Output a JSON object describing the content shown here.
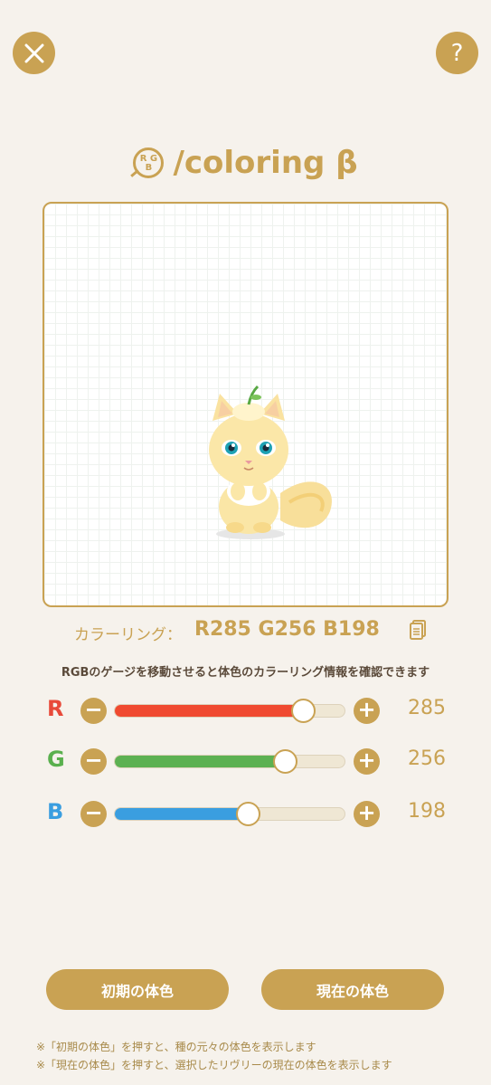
{
  "header": {
    "close_icon": "close-icon",
    "help_label": "?",
    "title_badge": "R G B",
    "title": "/coloring β"
  },
  "color_ring": {
    "label": "カラーリング：",
    "value": "R285 G256 B198",
    "copy_icon": "copy-icon"
  },
  "hint": "RGBのゲージを移動させると体色のカラーリング情報を確認できます",
  "sliders": [
    {
      "letter": "R",
      "value": "285",
      "level": 0.82,
      "letter_color": "#e84a3a",
      "fill_color": "#f04a30"
    },
    {
      "letter": "G",
      "value": "256",
      "level": 0.74,
      "letter_color": "#5ab04e",
      "fill_color": "#5db152"
    },
    {
      "letter": "B",
      "value": "198",
      "level": 0.58,
      "letter_color": "#3a9ee0",
      "fill_color": "#3a9ee0"
    }
  ],
  "buttons": {
    "initial": "初期の体色",
    "current": "現在の体色"
  },
  "notes": [
    "※「初期の体色」を押すと、種の元々の体色を表示します",
    "※「現在の体色」を押すと、選択したリヴリーの現在の体色を表示します"
  ],
  "colors": {
    "accent": "#c9a253",
    "background": "#f6f2ec"
  }
}
